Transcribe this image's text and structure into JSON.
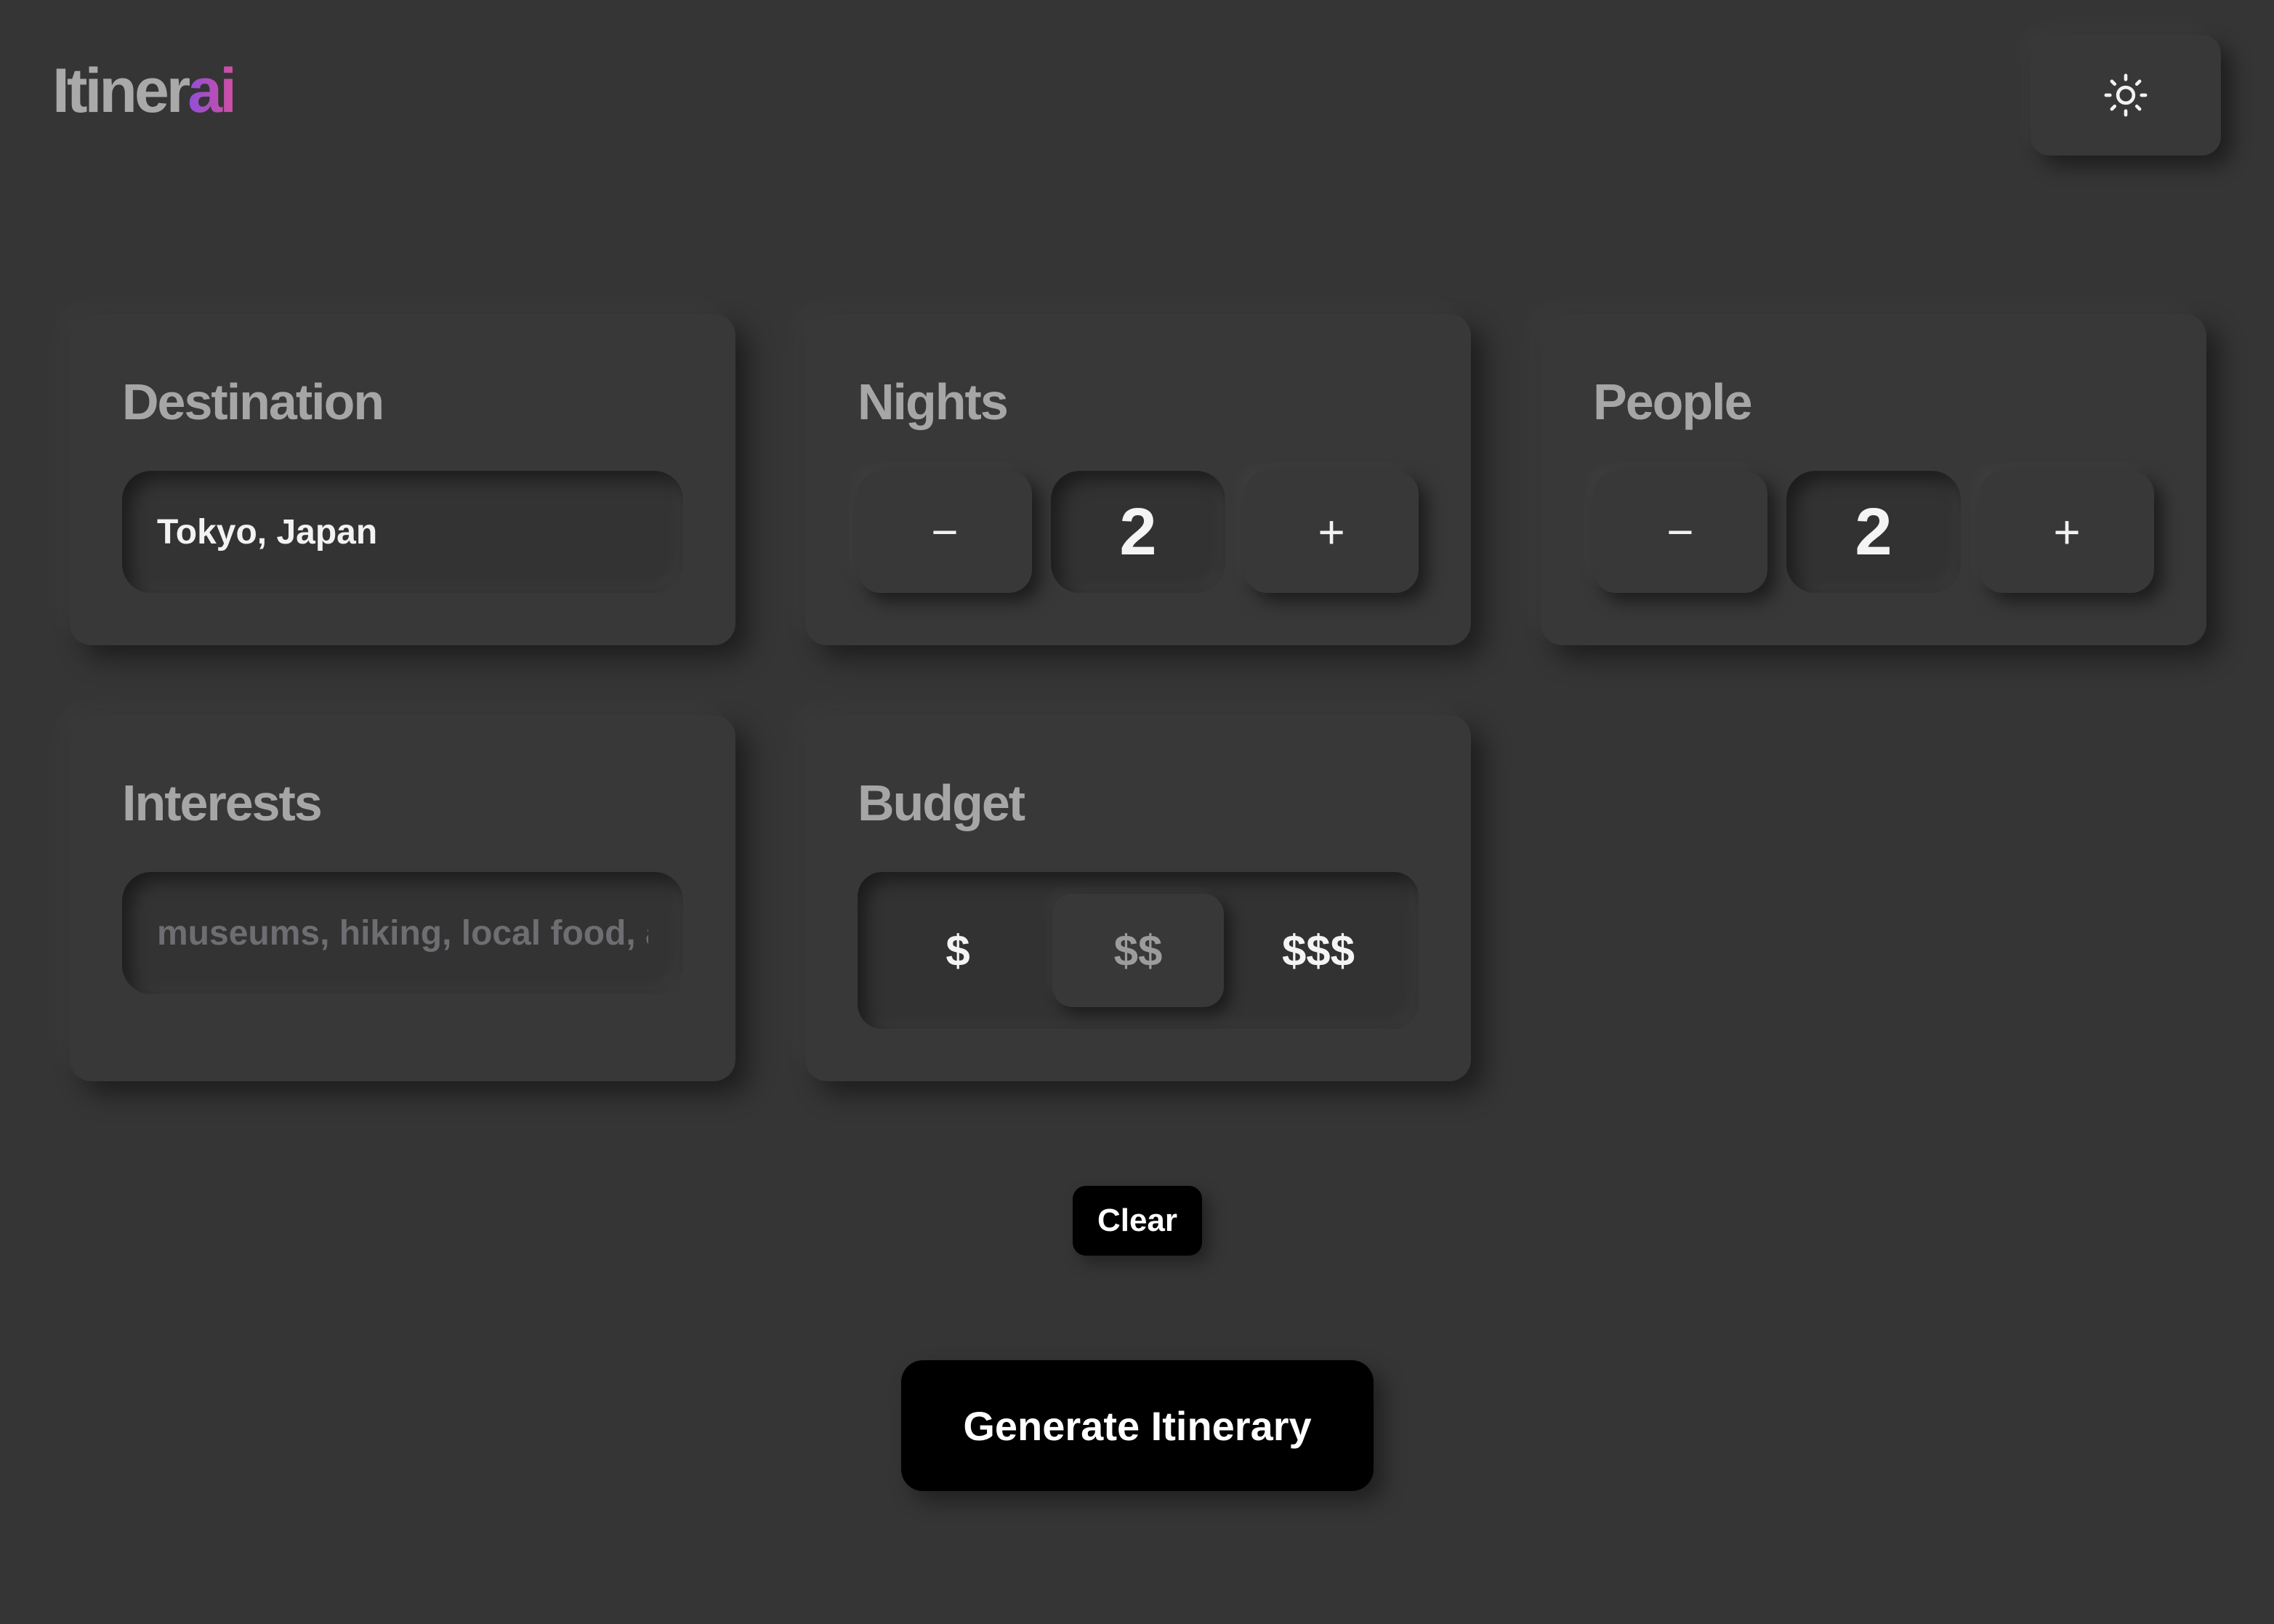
{
  "header": {
    "logo_main": "Itiner",
    "logo_accent": "ai",
    "theme_toggle_icon": "sun-icon"
  },
  "destination": {
    "title": "Destination",
    "value": "Tokyo, Japan",
    "placeholder": ""
  },
  "nights": {
    "title": "Nights",
    "decrement_label": "−",
    "value": "2",
    "increment_label": "+"
  },
  "people": {
    "title": "People",
    "decrement_label": "−",
    "value": "2",
    "increment_label": "+"
  },
  "interests": {
    "title": "Interests",
    "value": "",
    "placeholder": "museums, hiking, local food, a"
  },
  "budget": {
    "title": "Budget",
    "options": [
      "$",
      "$$",
      "$$$"
    ],
    "selected": "$$"
  },
  "actions": {
    "clear_label": "Clear",
    "generate_label": "Generate Itinerary"
  },
  "colors": {
    "background": "#353535",
    "card": "#383838",
    "logo_text": "#a9a9a9",
    "logo_gradient_start": "#8f4fd8",
    "logo_gradient_end": "#d04fa2",
    "button_dark": "#000000"
  }
}
